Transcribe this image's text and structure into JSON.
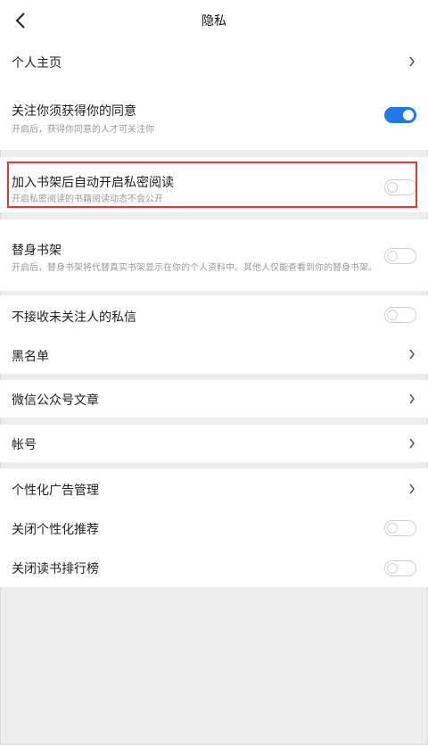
{
  "header": {
    "title": "隐私"
  },
  "items": {
    "profile": {
      "label": "个人主页"
    },
    "follow_consent": {
      "label": "关注你须获得你的同意",
      "desc": "开启后，获得你同意的人才可关注你",
      "enabled": true
    },
    "private_reading": {
      "label": "加入书架后自动开启私密阅读",
      "desc": "开启私密阅读的书籍阅读动态不会公开",
      "enabled": false
    },
    "proxy_shelf": {
      "label": "替身书架",
      "desc": "开启后，替身书架将代替真实书架显示在你的个人资料中。其他人仅能查看到你的替身书架。",
      "enabled": false
    },
    "block_messages": {
      "label": "不接收未关注人的私信",
      "enabled": false
    },
    "blacklist": {
      "label": "黑名单"
    },
    "wechat_articles": {
      "label": "微信公众号文章"
    },
    "account": {
      "label": "帐号"
    },
    "ad_management": {
      "label": "个性化广告管理"
    },
    "personalized_recommend": {
      "label": "关闭个性化推荐",
      "enabled": false
    },
    "reading_rank": {
      "label": "关闭读书排行榜",
      "enabled": false
    }
  },
  "colors": {
    "accent": "#1f7ae8",
    "highlight_border": "#e53935",
    "background": "#ededee"
  }
}
